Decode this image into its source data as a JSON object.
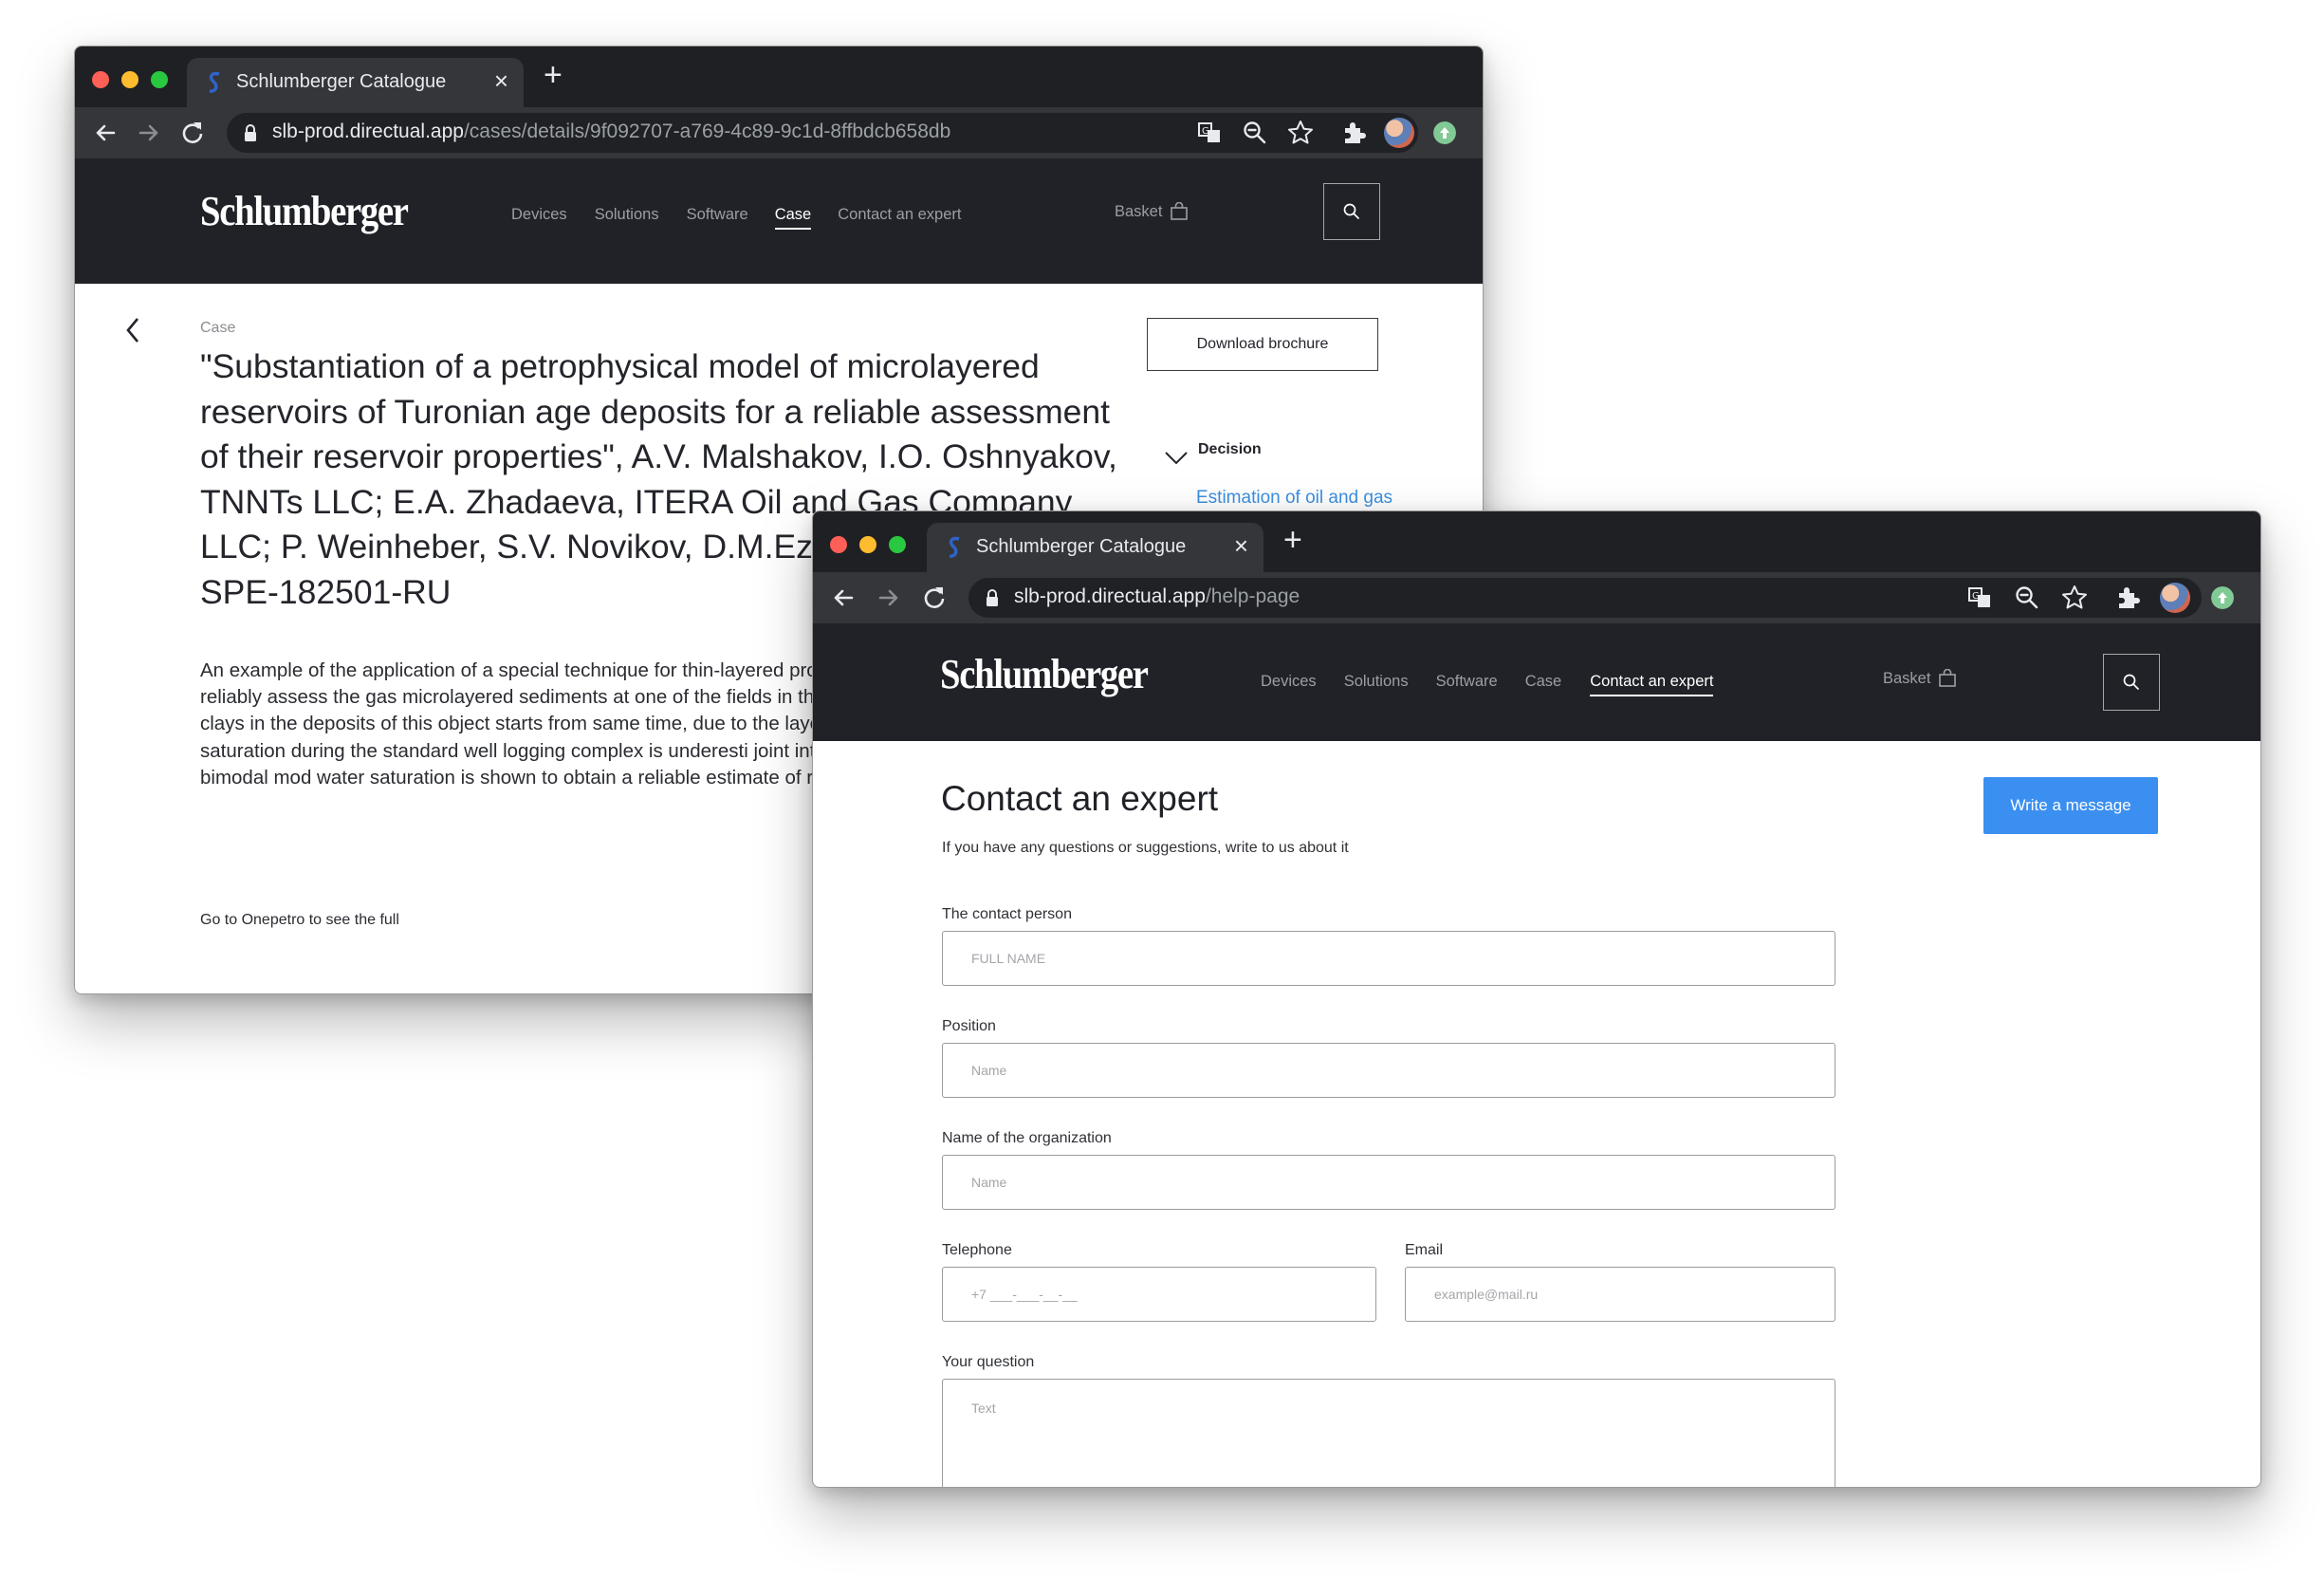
{
  "browser": {
    "tab_title": "Schlumberger Catalogue",
    "close_glyph": "×",
    "new_tab_glyph": "+"
  },
  "window1": {
    "url_host": "slb-prod.directual.app",
    "url_path": "/cases/details/9f092707-a769-4c89-9c1d-8ffbdcb658db",
    "header": {
      "logo": "Schlumberger",
      "nav": [
        "Devices",
        "Solutions",
        "Software",
        "Case",
        "Contact an expert"
      ],
      "active_nav": "Case",
      "basket_label": "Basket"
    },
    "case": {
      "label": "Case",
      "title": "\"Substantiation of a petrophysical model of microlayered reservoirs of Turonian age deposits for a reliable assessment of their reservoir properties\", A.V. Malshakov, I.O. Oshnyakov, TNNTs LLC; E.A. Zhadaeva, ITERA Oil and Gas Company LLC; P. Weinheber, S.V. Novikov, D.M.Ezersky, Schlumberger, SPE-182501-RU",
      "description": "An example of the application of a special technique for thin-layered processing triaxial IQ and NMC data in order to reliably assess the gas microlayered sediments at one of the fields in the north of western S of silty sandstones and clays in the deposits of this object starts from same time, due to the layered clay component of the reservoir resist gas saturation during the standard well logging complex is underesti joint interpretation of NMR and triaxial IR data using a bimodal mod water saturation is shown to obtain a reliable estimate of reservoir p",
      "goto_text": "Go to  Onepetro to see the full",
      "download_button": "Download brochure",
      "decision_label": "Decision",
      "decision_link": "Estimation of oil and gas saturation and"
    }
  },
  "window2": {
    "url_host": "slb-prod.directual.app",
    "url_path": "/help-page",
    "header": {
      "logo": "Schlumberger",
      "nav": [
        "Devices",
        "Solutions",
        "Software",
        "Case",
        "Contact an expert"
      ],
      "active_nav": "Contact an expert",
      "basket_label": "Basket"
    },
    "contact": {
      "title": "Contact an expert",
      "subtitle": "If you have any questions or suggestions, write to us about it",
      "write_button": "Write a message",
      "fields": {
        "contact_person": {
          "label": "The contact person",
          "placeholder": "FULL NAME"
        },
        "position": {
          "label": "Position",
          "placeholder": "Name"
        },
        "organization": {
          "label": "Name of the organization",
          "placeholder": "Name"
        },
        "telephone": {
          "label": "Telephone",
          "placeholder": "+7 ___-___-__-__"
        },
        "email": {
          "label": "Email",
          "placeholder": "example@mail.ru"
        },
        "question": {
          "label": "Your question",
          "placeholder": "Text"
        }
      }
    }
  },
  "colors": {
    "chrome_dark": "#1f2023",
    "chrome_toolbar": "#35363a",
    "site_header": "#202228",
    "accent_blue": "#3b8ff0",
    "link_blue": "#3b8fe0"
  }
}
